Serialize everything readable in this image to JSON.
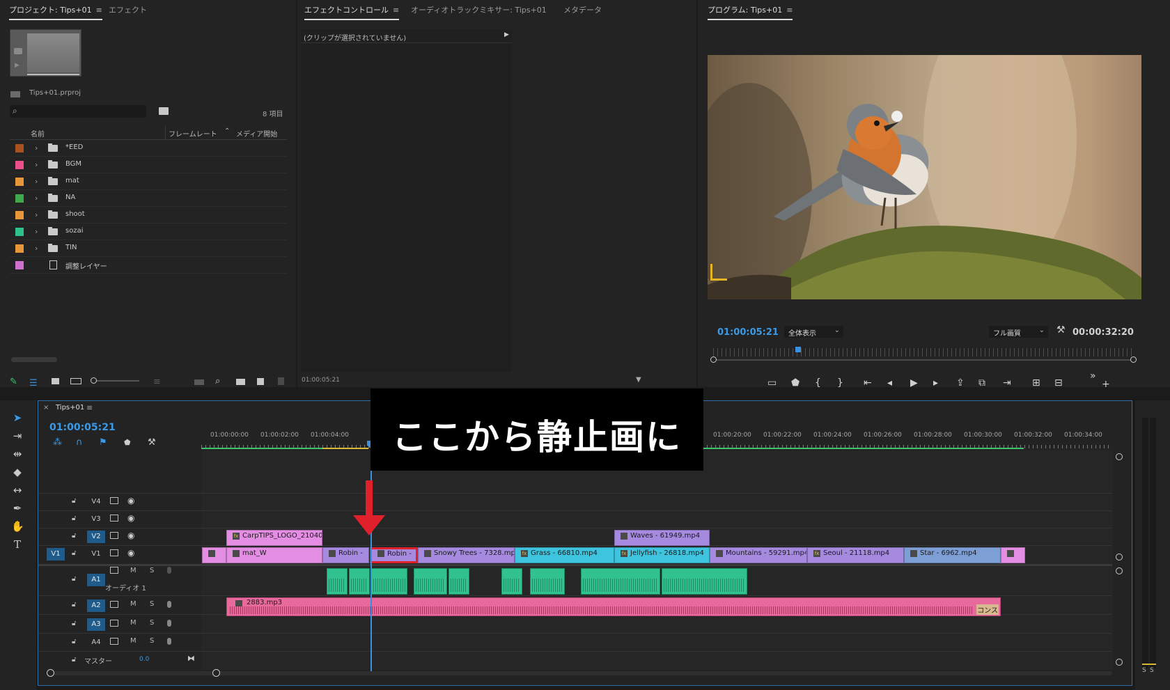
{
  "project": {
    "tab_active": "プロジェクト: Tips+01",
    "tab_other": "エフェクト",
    "file_name": "Tips+01.prproj",
    "item_count": "8 項目",
    "col_name": "名前",
    "col_framerate": "フレームレート",
    "col_media_start": "メディア開始",
    "items": [
      {
        "label": "*EED",
        "color": "#a8531f"
      },
      {
        "label": "BGM",
        "color": "#e94f8a"
      },
      {
        "label": "mat",
        "color": "#e8963a"
      },
      {
        "label": "NA",
        "color": "#3ea84a"
      },
      {
        "label": "shoot",
        "color": "#e8963a"
      },
      {
        "label": "sozai",
        "color": "#2cc28a"
      },
      {
        "label": "TIN",
        "color": "#e8963a"
      },
      {
        "label": "調整レイヤー",
        "color": "#d070d0"
      }
    ]
  },
  "effects": {
    "tab_active": "エフェクトコントロール",
    "tab_mixer": "オーディオトラックミキサー: Tips+01",
    "tab_meta": "メタデータ",
    "no_clip": "(クリップが選択されていません)",
    "timecode": "01:00:05:21"
  },
  "program": {
    "tab": "プログラム: Tips+01",
    "timecode": "01:00:05:21",
    "zoom": "全体表示",
    "quality": "フル画質",
    "duration": "00:00:32:20"
  },
  "timeline": {
    "tab": "Tips+01",
    "timecode": "01:00:05:21",
    "ruler": [
      "01:00:00:00",
      "01:00:02:00",
      "01:00:04:00",
      "01:00:20:00",
      "01:00:22:00",
      "01:00:24:00",
      "01:00:26:00",
      "01:00:28:00",
      "01:00:30:00",
      "01:00:32:00",
      "01:00:34:00"
    ],
    "tracks": {
      "v4": "V4",
      "v3": "V3",
      "v2": "V2",
      "v1": "V1",
      "v1_src": "V1",
      "a1": "A1",
      "a1_name": "オーディオ 1",
      "a2": "A2",
      "a3": "A3",
      "a4": "A4",
      "master": "マスター",
      "master_val": "0.0",
      "m": "M",
      "s": "S"
    },
    "clips_v2": {
      "logo": "CarpTIPS_LOGO_21040",
      "waves": "Waves - 61949.mp4"
    },
    "clips_v1": {
      "mat": "mat_W",
      "robin1": "Robin -",
      "robin2": "Robin -",
      "snowy": "Snowy Trees - 7328.mp4",
      "grass": "Grass - 66810.mp4",
      "jelly": "Jellyfish - 26818.mp4",
      "mountains": "Mountains - 59291.mp4",
      "seoul": "Seoul - 21118.mp4",
      "star": "Star - 6962.mp4"
    },
    "clip_a2": "2883.mp3",
    "clip_a2_end": "コンス"
  },
  "annotation": {
    "caption": "ここから静止画に"
  }
}
